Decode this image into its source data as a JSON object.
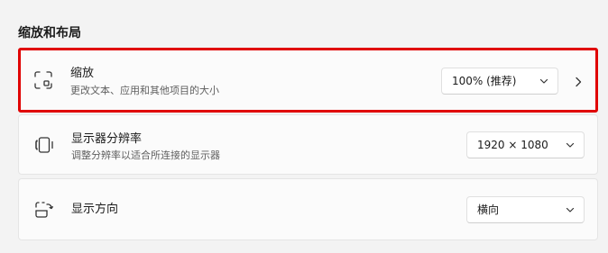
{
  "section": {
    "title": "缩放和布局"
  },
  "scale": {
    "title": "缩放",
    "subtitle": "更改文本、应用和其他项目的大小",
    "value": "100% (推荐)",
    "icon": "scale-icon"
  },
  "resolution": {
    "title": "显示器分辨率",
    "subtitle": "调整分辨率以适合所连接的显示器",
    "value": "1920 × 1080",
    "icon": "resolution-icon"
  },
  "orientation": {
    "title": "显示方向",
    "value": "横向",
    "icon": "orientation-icon"
  },
  "colors": {
    "highlight": "#e00000",
    "background": "#f3f3f3",
    "card": "#fbfbfb"
  }
}
